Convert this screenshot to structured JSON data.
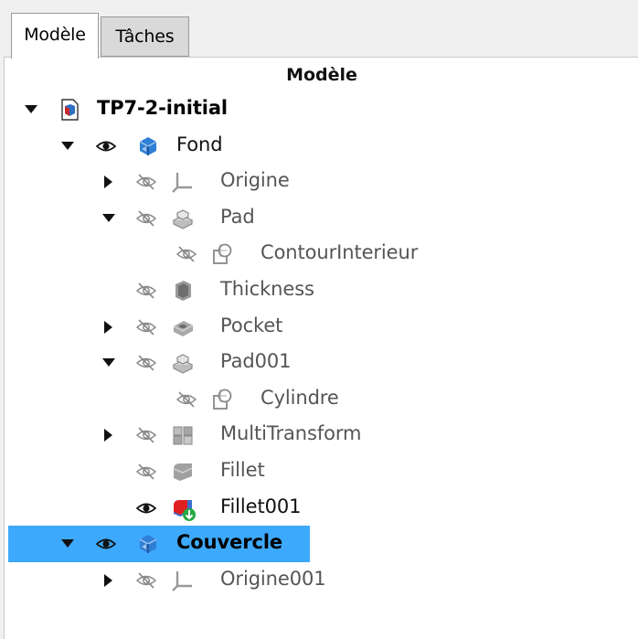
{
  "tabs": [
    {
      "label": "Modèle",
      "active": true
    },
    {
      "label": "Tâches",
      "active": false
    }
  ],
  "tree": {
    "header": "Modèle",
    "items": [
      {
        "label": "TP7-2-initial",
        "style": "bold",
        "icon": "document-icon",
        "expand": "down",
        "eye": "none"
      },
      {
        "label": "Fond",
        "style": "normal",
        "icon": "body-icon",
        "expand": "down",
        "eye": "visible"
      },
      {
        "label": "Origine",
        "style": "dim",
        "icon": "origin-icon",
        "expand": "right",
        "eye": "hidden"
      },
      {
        "label": "Pad",
        "style": "dim",
        "icon": "pad-icon",
        "expand": "down",
        "eye": "hidden"
      },
      {
        "label": "ContourInterieur",
        "style": "dim",
        "icon": "sketch-icon",
        "expand": "none",
        "eye": "hidden"
      },
      {
        "label": "Thickness",
        "style": "dim",
        "icon": "thickness-icon",
        "expand": "none",
        "eye": "hidden"
      },
      {
        "label": "Pocket",
        "style": "dim",
        "icon": "pocket-icon",
        "expand": "right",
        "eye": "hidden"
      },
      {
        "label": "Pad001",
        "style": "dim",
        "icon": "pad-icon",
        "expand": "down",
        "eye": "hidden"
      },
      {
        "label": "Cylindre",
        "style": "dim",
        "icon": "sketch-icon",
        "expand": "none",
        "eye": "hidden"
      },
      {
        "label": "MultiTransform",
        "style": "dim",
        "icon": "multitransform-icon",
        "expand": "right",
        "eye": "hidden"
      },
      {
        "label": "Fillet",
        "style": "dim",
        "icon": "fillet-icon",
        "expand": "none",
        "eye": "hidden"
      },
      {
        "label": "Fillet001",
        "style": "normal",
        "icon": "fillet-tip-icon",
        "expand": "none",
        "eye": "visible"
      },
      {
        "label": "Couvercle",
        "style": "bold",
        "icon": "body-icon",
        "expand": "down",
        "eye": "visible",
        "selected": true
      },
      {
        "label": "Origine001",
        "style": "dim",
        "icon": "origin-icon",
        "expand": "right",
        "eye": "hidden"
      }
    ]
  },
  "colors": {
    "selection": "#3da9fc",
    "body_blue": "#2f7fd6",
    "fillet_red": "#e02020",
    "tip_green": "#27a844"
  }
}
